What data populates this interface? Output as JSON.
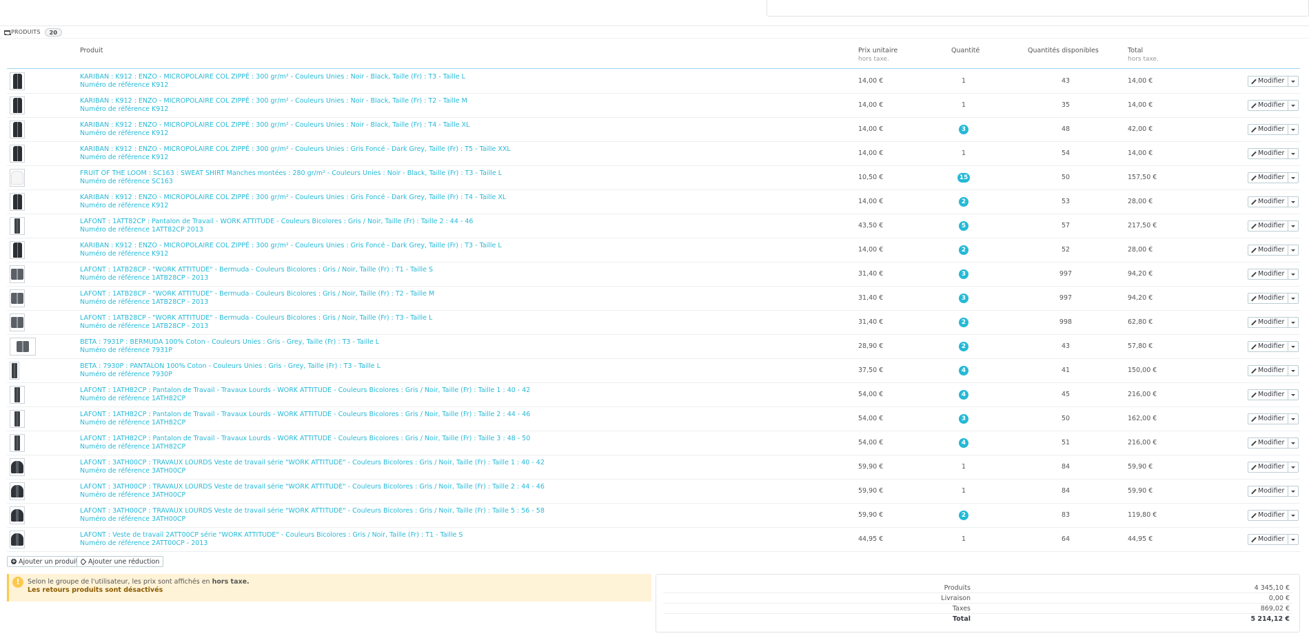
{
  "panel": {
    "title": "PRODUITS",
    "count": "20"
  },
  "columns": {
    "product": "Produit",
    "unit_price": "Prix unitaire",
    "unit_price_sub": "hors taxe.",
    "quantity": "Quantité",
    "available": "Quantités disponibles",
    "total": "Total",
    "total_sub": "hors taxe."
  },
  "edit_label": "Modifier",
  "rows": [
    {
      "name": "KARIBAN : K912 : ENZO - MICROPOLAIRE COL ZIPPÉ : 300 gr/m² - Couleurs Unies : Noir - Black, Taille (Fr) : T3 - Taille L",
      "ref": "Numéro de référence K912",
      "price": "14,00 €",
      "qty": "1",
      "badge": false,
      "available": "43",
      "total": "14,00 €",
      "thumb": "fleece"
    },
    {
      "name": "KARIBAN : K912 : ENZO - MICROPOLAIRE COL ZIPPÉ : 300 gr/m² - Couleurs Unies : Noir - Black, Taille (Fr) : T2 - Taille M",
      "ref": "Numéro de référence K912",
      "price": "14,00 €",
      "qty": "1",
      "badge": false,
      "available": "35",
      "total": "14,00 €",
      "thumb": "fleece"
    },
    {
      "name": "KARIBAN : K912 : ENZO - MICROPOLAIRE COL ZIPPÉ : 300 gr/m² - Couleurs Unies : Noir - Black, Taille (Fr) : T4 - Taille XL",
      "ref": "Numéro de référence K912",
      "price": "14,00 €",
      "qty": "3",
      "badge": true,
      "available": "48",
      "total": "42,00 €",
      "thumb": "fleece"
    },
    {
      "name": "KARIBAN : K912 : ENZO - MICROPOLAIRE COL ZIPPÉ : 300 gr/m² - Couleurs Unies : Gris Foncé - Dark Grey, Taille (Fr) : T5 - Taille XXL",
      "ref": "Numéro de référence K912",
      "price": "14,00 €",
      "qty": "1",
      "badge": false,
      "available": "54",
      "total": "14,00 €",
      "thumb": "fleece"
    },
    {
      "name": "FRUIT OF THE LOOM : SC163 : SWEAT SHIRT Manches montées : 280 gr/m² - Couleurs Unies : Noir - Black, Taille (Fr) : T3 - Taille L",
      "ref": "Numéro de référence SC163",
      "price": "10,50 €",
      "qty": "15",
      "badge": true,
      "available": "50",
      "total": "157,50 €",
      "thumb": "shirt"
    },
    {
      "name": "KARIBAN : K912 : ENZO - MICROPOLAIRE COL ZIPPÉ : 300 gr/m² - Couleurs Unies : Gris Foncé - Dark Grey, Taille (Fr) : T4 - Taille XL",
      "ref": "Numéro de référence K912",
      "price": "14,00 €",
      "qty": "2",
      "badge": true,
      "available": "53",
      "total": "28,00 €",
      "thumb": "fleece"
    },
    {
      "name": "LAFONT : 1ATT82CP : Pantalon de Travail - WORK ATTITUDE - Couleurs Bicolores : Gris / Noir, Taille (Fr) : Taille 2 : 44 - 46",
      "ref": "Numéro de référence 1ATT82CP 2013",
      "price": "43,50 €",
      "qty": "5",
      "badge": true,
      "available": "57",
      "total": "217,50 €",
      "thumb": "pants"
    },
    {
      "name": "KARIBAN : K912 : ENZO - MICROPOLAIRE COL ZIPPÉ : 300 gr/m² - Couleurs Unies : Gris Foncé - Dark Grey, Taille (Fr) : T3 - Taille L",
      "ref": "Numéro de référence K912",
      "price": "14,00 €",
      "qty": "2",
      "badge": true,
      "available": "52",
      "total": "28,00 €",
      "thumb": "fleece"
    },
    {
      "name": "LAFONT : 1ATB28CP - \"WORK ATTITUDE\" - Bermuda - Couleurs Bicolores : Gris / Noir, Taille (Fr) : T1 - Taille S",
      "ref": "Numéro de référence 1ATB28CP - 2013",
      "price": "31,40 €",
      "qty": "3",
      "badge": true,
      "available": "997",
      "total": "94,20 €",
      "thumb": "shorts"
    },
    {
      "name": "LAFONT : 1ATB28CP - \"WORK ATTITUDE\" - Bermuda - Couleurs Bicolores : Gris / Noir, Taille (Fr) : T2 - Taille M",
      "ref": "Numéro de référence 1ATB28CP - 2013",
      "price": "31,40 €",
      "qty": "3",
      "badge": true,
      "available": "997",
      "total": "94,20 €",
      "thumb": "shorts"
    },
    {
      "name": "LAFONT : 1ATB28CP - \"WORK ATTITUDE\" - Bermuda - Couleurs Bicolores : Gris / Noir, Taille (Fr) : T3 - Taille L",
      "ref": "Numéro de référence 1ATB28CP - 2013",
      "price": "31,40 €",
      "qty": "2",
      "badge": true,
      "available": "998",
      "total": "62,80 €",
      "thumb": "shorts"
    },
    {
      "name": "BETA : 7931P : BERMUDA 100% Coton - Couleurs Unies : Gris - Grey, Taille (Fr) : T3 - Taille L",
      "ref": "Numéro de référence 7931P",
      "price": "28,90 €",
      "qty": "2",
      "badge": true,
      "available": "43",
      "total": "57,80 €",
      "thumb": "shorts-wide"
    },
    {
      "name": "BETA : 7930P : PANTALON 100% Coton - Couleurs Unies : Gris - Grey, Taille (Fr) : T3 - Taille L",
      "ref": "Numéro de référence 7930P",
      "price": "37,50 €",
      "qty": "4",
      "badge": true,
      "available": "41",
      "total": "150,00 €",
      "thumb": "pants-narrow"
    },
    {
      "name": "LAFONT : 1ATH82CP : Pantalon de Travail - Travaux Lourds - WORK ATTITUDE - Couleurs Bicolores : Gris / Noir, Taille (Fr) : Taille 1 : 40 - 42",
      "ref": "Numéro de référence 1ATH82CP",
      "price": "54,00 €",
      "qty": "4",
      "badge": true,
      "available": "45",
      "total": "216,00 €",
      "thumb": "pants"
    },
    {
      "name": "LAFONT : 1ATH82CP : Pantalon de Travail - Travaux Lourds - WORK ATTITUDE - Couleurs Bicolores : Gris / Noir, Taille (Fr) : Taille 2 : 44 - 46",
      "ref": "Numéro de référence 1ATH82CP",
      "price": "54,00 €",
      "qty": "3",
      "badge": true,
      "available": "50",
      "total": "162,00 €",
      "thumb": "pants"
    },
    {
      "name": "LAFONT : 1ATH82CP : Pantalon de Travail - Travaux Lourds - WORK ATTITUDE - Couleurs Bicolores : Gris / Noir, Taille (Fr) : Taille 3 : 48 - 50",
      "ref": "Numéro de référence 1ATH82CP",
      "price": "54,00 €",
      "qty": "4",
      "badge": true,
      "available": "51",
      "total": "216,00 €",
      "thumb": "pants"
    },
    {
      "name": "LAFONT : 3ATH00CP : TRAVAUX LOURDS Veste de travail série \"WORK ATTITUDE\" - Couleurs Bicolores : Gris / Noir, Taille (Fr) : Taille 1 : 40 - 42",
      "ref": "Numéro de référence 3ATH00CP",
      "price": "59,90 €",
      "qty": "1",
      "badge": false,
      "available": "84",
      "total": "59,90 €",
      "thumb": "jacket"
    },
    {
      "name": "LAFONT : 3ATH00CP : TRAVAUX LOURDS Veste de travail série \"WORK ATTITUDE\" - Couleurs Bicolores : Gris / Noir, Taille (Fr) : Taille 2 : 44 - 46",
      "ref": "Numéro de référence 3ATH00CP",
      "price": "59,90 €",
      "qty": "1",
      "badge": false,
      "available": "84",
      "total": "59,90 €",
      "thumb": "jacket"
    },
    {
      "name": "LAFONT : 3ATH00CP : TRAVAUX LOURDS Veste de travail série \"WORK ATTITUDE\" - Couleurs Bicolores : Gris / Noir, Taille (Fr) : Taille 5 : 56 - 58",
      "ref": "Numéro de référence 3ATH00CP",
      "price": "59,90 €",
      "qty": "2",
      "badge": true,
      "available": "83",
      "total": "119,80 €",
      "thumb": "jacket"
    },
    {
      "name": "LAFONT : Veste de travail 2ATT00CP série \"WORK ATTITUDE\" - Couleurs Bicolores : Gris / Noir, Taille (Fr) : T1 - Taille S",
      "ref": "Numéro de référence 2ATT00CP - 2013",
      "price": "44,95 €",
      "qty": "1",
      "badge": false,
      "available": "64",
      "total": "44,95 €",
      "thumb": "jacket"
    }
  ],
  "actions": {
    "add_product": "Ajouter un produit",
    "add_discount": "Ajouter une réduction"
  },
  "alert": {
    "text_before": "Selon le groupe de l'utilisateur, les prix sont affichés en ",
    "text_bold": "hors taxe.",
    "returns": "Les retours produits sont désactivés"
  },
  "totals": {
    "products_label": "Produits",
    "products_value": "4 345,10 €",
    "shipping_label": "Livraison",
    "shipping_value": "0,00 €",
    "taxes_label": "Taxes",
    "taxes_value": "869,02 €",
    "total_label": "Total",
    "total_value": "5 214,12 €"
  },
  "colors": {
    "link": "#25b9d7",
    "badge": "#25b9d7",
    "alert_bg": "#fff3d7",
    "alert_border": "#fcc94f"
  }
}
